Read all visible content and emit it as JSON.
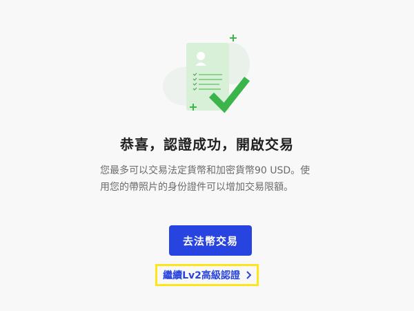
{
  "success": {
    "title": "恭喜，認證成功，開啟交易",
    "description": "您最多可以交易法定貨幣和加密貨幣90 USD。使用您的帶照片的身份證件可以增加交易限額。"
  },
  "actions": {
    "primary_label": "去法幣交易",
    "secondary_link": "繼續Lv2高級認證"
  },
  "icons": {
    "illustration": "document-checkmark-icon",
    "link_arrow": "chevron-right-icon"
  },
  "colors": {
    "accent": "#2743e0",
    "success_green": "#3bb54a",
    "highlight": "#ffe419"
  }
}
